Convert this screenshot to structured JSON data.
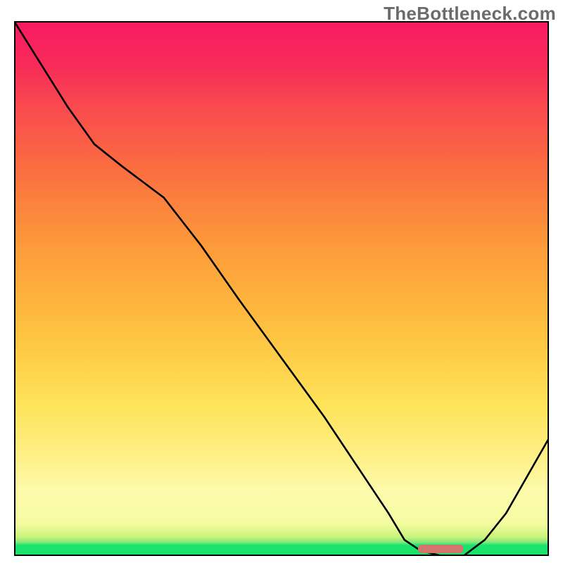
{
  "watermark": "TheBottleneck.com",
  "colors": {
    "curve": "#000000",
    "optimum_marker": "#d4756c",
    "gradient_top": "#f71a63",
    "gradient_mid": "#fee45a",
    "gradient_bottom": "#19e36a"
  },
  "chart_data": {
    "type": "line",
    "title": "",
    "xlabel": "",
    "ylabel": "",
    "x": [
      0.0,
      0.05,
      0.1,
      0.15,
      0.2,
      0.24,
      0.28,
      0.35,
      0.42,
      0.5,
      0.58,
      0.64,
      0.7,
      0.73,
      0.76,
      0.8,
      0.84,
      0.88,
      0.92,
      0.96,
      1.0
    ],
    "values": [
      100,
      92,
      84,
      77,
      73,
      70,
      67,
      58,
      48,
      37,
      26,
      17,
      8,
      3,
      1,
      0,
      0,
      3,
      8,
      15,
      22
    ],
    "ylim": [
      0,
      100
    ],
    "xlim": [
      0,
      1
    ],
    "optimum_marker": {
      "x_start": 0.755,
      "x_end": 0.84,
      "y": 0.012
    },
    "legend": false,
    "grid": false
  }
}
